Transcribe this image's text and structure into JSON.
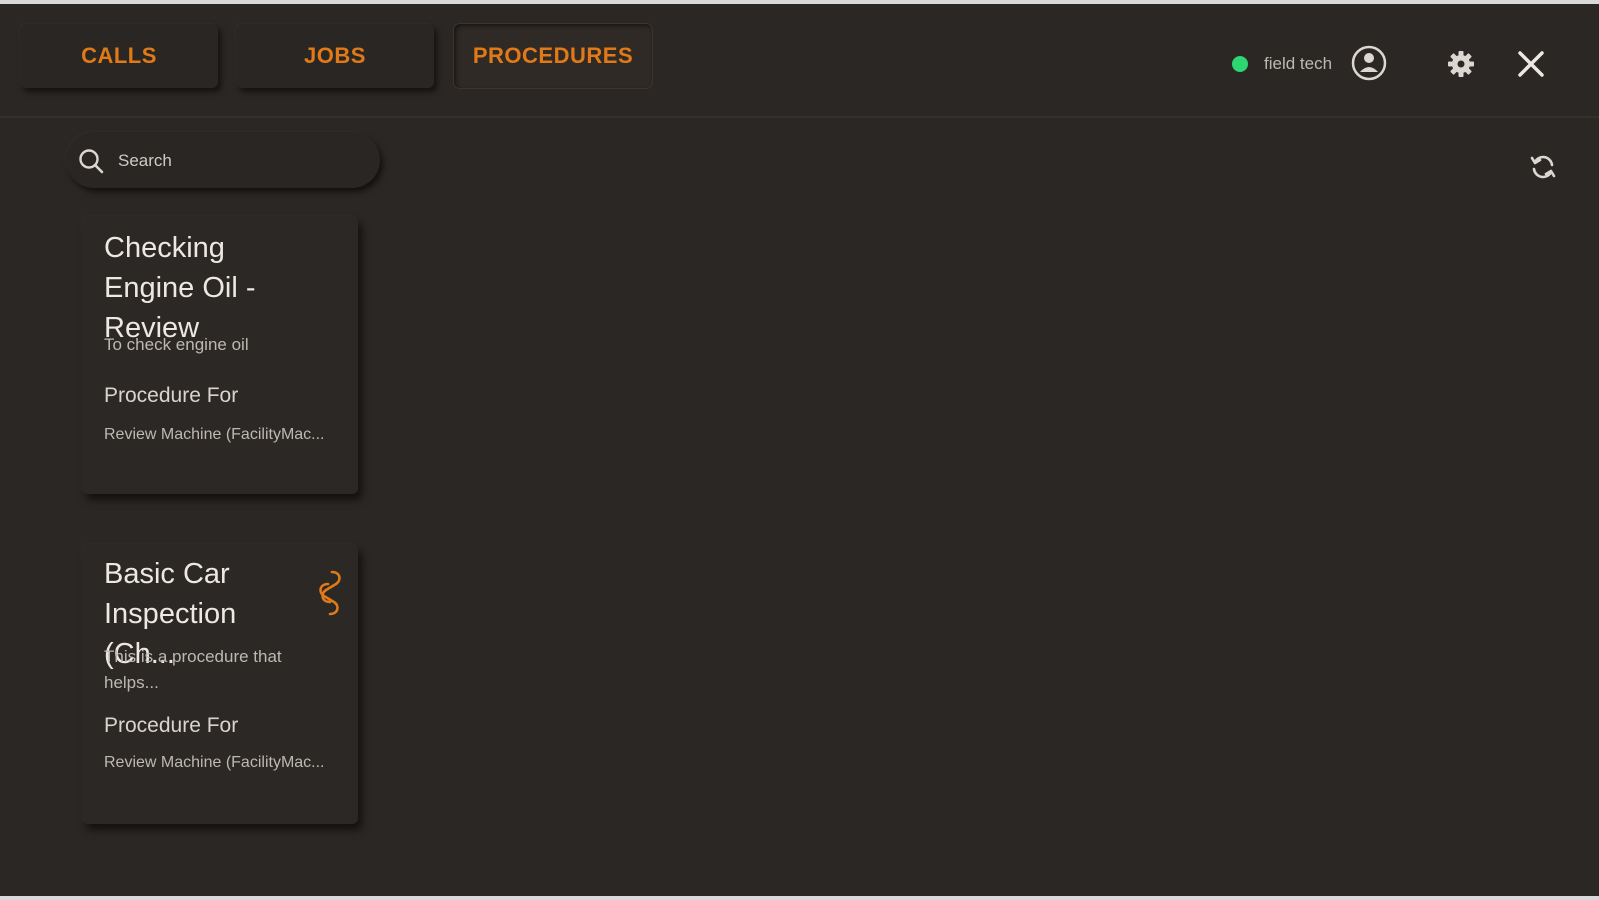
{
  "tabs": [
    {
      "label": "CALLS"
    },
    {
      "label": "JOBS"
    },
    {
      "label": "PROCEDURES"
    }
  ],
  "header": {
    "status_color": "#2ed573",
    "user_name": "field tech"
  },
  "search": {
    "placeholder": "Search"
  },
  "cards": [
    {
      "title": "Checking Engine Oil - Review",
      "description": "To check engine oil",
      "label": "Procedure For",
      "value": "Review Machine (FacilityMac..."
    },
    {
      "title": "Basic Car Inspection (Ch...",
      "description": "This is a procedure that helps...",
      "label": "Procedure For",
      "value": "Review Machine (FacilityMac...",
      "icon": "link-chain-icon"
    }
  ],
  "colors": {
    "accent": "#e07a18",
    "background": "#2b2724"
  }
}
